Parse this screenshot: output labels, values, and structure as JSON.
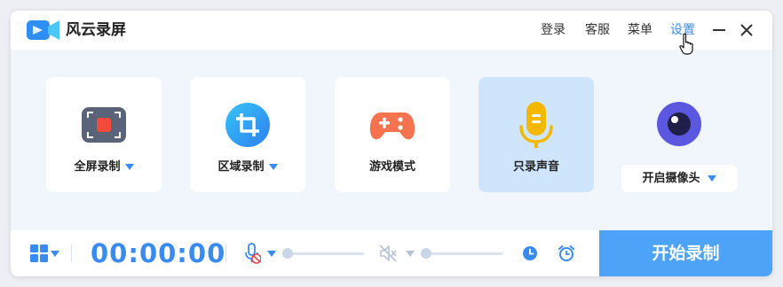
{
  "app": {
    "title": "风云录屏"
  },
  "header_nav": {
    "login": "登录",
    "support": "客服",
    "menu": "菜单",
    "settings": "设置"
  },
  "modes": [
    {
      "label": "全屏录制",
      "icon": "fullscreen-record-icon",
      "has_dropdown": true
    },
    {
      "label": "区域录制",
      "icon": "crop-region-icon",
      "has_dropdown": true
    },
    {
      "label": "游戏模式",
      "icon": "gamepad-icon",
      "has_dropdown": false
    },
    {
      "label": "只录声音",
      "icon": "microphone-icon",
      "has_dropdown": false,
      "selected": true
    }
  ],
  "camera": {
    "label": "开启摄像头",
    "icon": "camera-icon"
  },
  "bottom": {
    "timer": "00:00:00",
    "mic_volume": 0,
    "speaker_volume": 0,
    "start_label": "开始录制"
  },
  "colors": {
    "accent": "#3a8bf0",
    "start_button": "#4da3f7",
    "selected_mode_bg": "#cfe5fb",
    "record_red": "#f24b3c",
    "game_orange": "#f5734f",
    "mic_yellow": "#f5b800",
    "camera_purple": "#5b57e0"
  }
}
